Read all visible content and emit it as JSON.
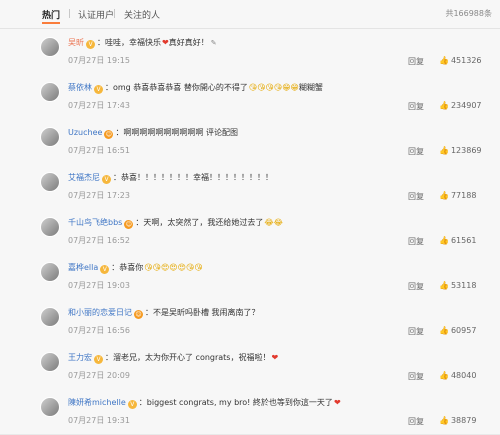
{
  "tabs": [
    "热门",
    "认证用户",
    "关注的人"
  ],
  "total": "共166988条",
  "comments": [
    {
      "user": "吴昕",
      "badge": "V",
      "text": "：哇哇，幸福快乐",
      "emojis": "❤",
      "tail": "真好真好！",
      "extra": "✎",
      "time": "07月27日 19:15",
      "reply": "回复",
      "likes": "451326"
    },
    {
      "user": "蔡依林",
      "badge": "V",
      "text": "：omg 恭喜恭喜恭喜 替你開心的不得了",
      "emojis": "😘😘😘😘😁😁",
      "tail": "糊糊蟹",
      "extra": "",
      "time": "07月27日 17:43",
      "reply": "回复",
      "likes": "234907"
    },
    {
      "user": "Uzuchee",
      "badge": "😊",
      "text": "：啊啊啊啊啊啊啊啊啊啊 评论配图",
      "emojis": "",
      "tail": "",
      "extra": "",
      "time": "07月27日 16:51",
      "reply": "回复",
      "likes": "123869"
    },
    {
      "user": "艾福杰尼",
      "badge": "V",
      "text": "：恭喜！！！！！！！幸福！！！！！！！！",
      "emojis": "",
      "tail": "",
      "extra": "",
      "time": "07月27日 17:23",
      "reply": "回复",
      "likes": "77188"
    },
    {
      "user": "千山鸟飞绝bbs",
      "badge": "😊",
      "text": "：天啊，太突然了，我还给她过去了",
      "emojis": "😂😂",
      "tail": "",
      "extra": "",
      "time": "07月27日 16:52",
      "reply": "回复",
      "likes": "61561"
    },
    {
      "user": "嘉桦ella",
      "badge": "V",
      "text": "：恭喜你",
      "emojis": "😘😘😍😍😍😘😘",
      "tail": "",
      "extra": "",
      "time": "07月27日 19:03",
      "reply": "回复",
      "likes": "53118"
    },
    {
      "user": "和小丽的恋爱日记",
      "badge": "😊",
      "text": "：不是吴昕吗卧槽 我闹离南了？",
      "emojis": "",
      "tail": "",
      "extra": "",
      "time": "07月27日 16:56",
      "reply": "回复",
      "likes": "60957"
    },
    {
      "user": "王力宏",
      "badge": "V",
      "text": "：溜老兄，太为你开心了 congrats，祝福啦！",
      "emojis": "❤",
      "tail": "",
      "extra": "",
      "time": "07月27日 20:09",
      "reply": "回复",
      "likes": "48040"
    },
    {
      "user": "陳妍希michelle",
      "badge": "V",
      "text": "：biggest congrats, my bro! 終於也等到你這一天了",
      "emojis": "❤",
      "tail": "",
      "extra": "",
      "time": "07月27日 19:31",
      "reply": "回复",
      "likes": "38879"
    }
  ]
}
